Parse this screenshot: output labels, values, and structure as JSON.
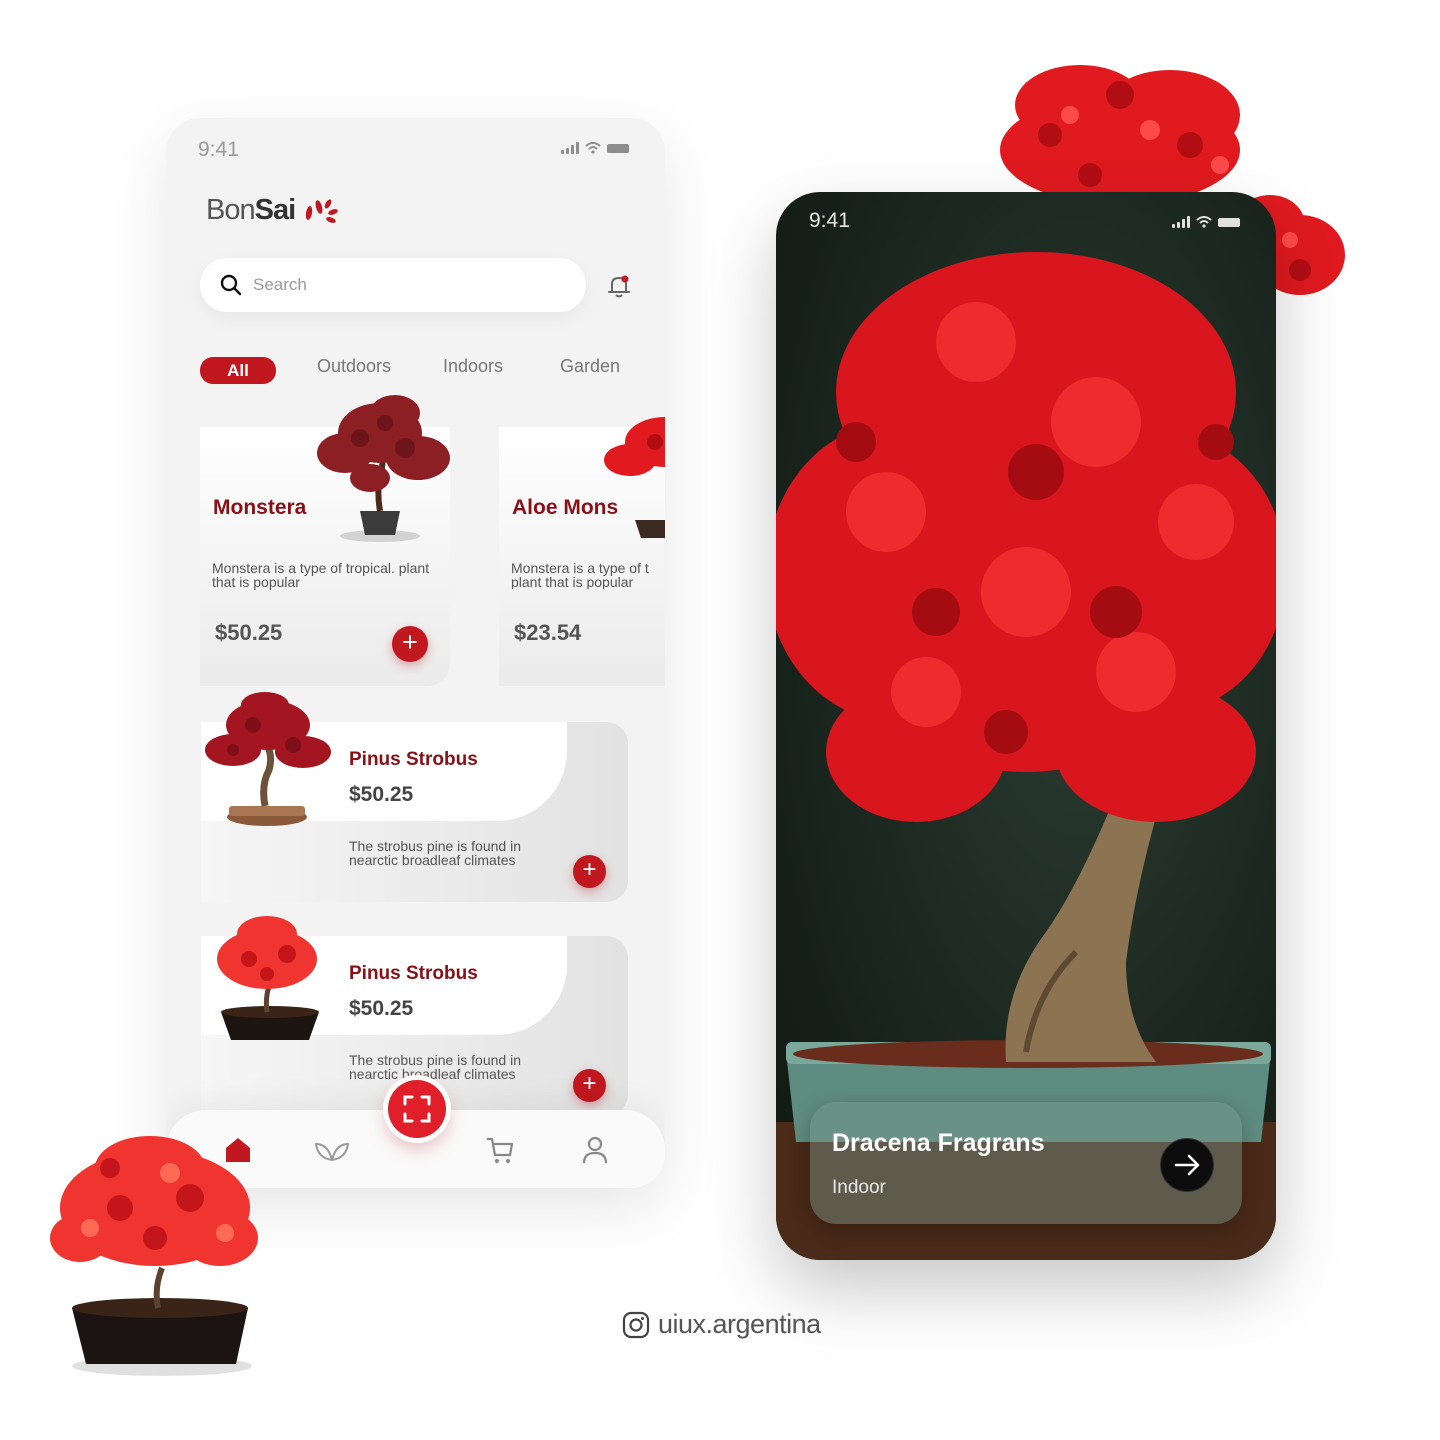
{
  "left_phone": {
    "status_time": "9:41",
    "logo": {
      "part1": "Bon",
      "part2": "Sai"
    },
    "search": {
      "placeholder": "Search"
    },
    "tabs": [
      {
        "label": "All",
        "active": true
      },
      {
        "label": "Outdoors"
      },
      {
        "label": "Indoors"
      },
      {
        "label": "Garden"
      }
    ],
    "featured": [
      {
        "name": "Monstera",
        "description": "Monstera is a type of tropical. plant that is popular",
        "price": "$50.25"
      },
      {
        "name": "Aloe Mons",
        "description": "Monstera is a type of t plant that is popular",
        "price": "$23.54"
      }
    ],
    "list": [
      {
        "name": "Pinus Strobus",
        "price": "$50.25",
        "description": "The strobus pine is found in nearctic broadleaf climates"
      },
      {
        "name": "Pinus Strobus",
        "price": "$50.25",
        "description": "The strobus pine is found in nearctic broadleaf climates"
      }
    ],
    "nav": [
      "home-icon",
      "leaf-icon",
      "scan-icon",
      "cart-icon",
      "user-icon"
    ]
  },
  "right_phone": {
    "status_time": "9:41",
    "product": {
      "name": "Dracena Fragrans",
      "category": "Indoor"
    }
  },
  "credit": {
    "handle": "uiux.argentina"
  },
  "colors": {
    "accent": "#c1181f",
    "dark_red": "#8a1018",
    "background": "#ffffff"
  }
}
